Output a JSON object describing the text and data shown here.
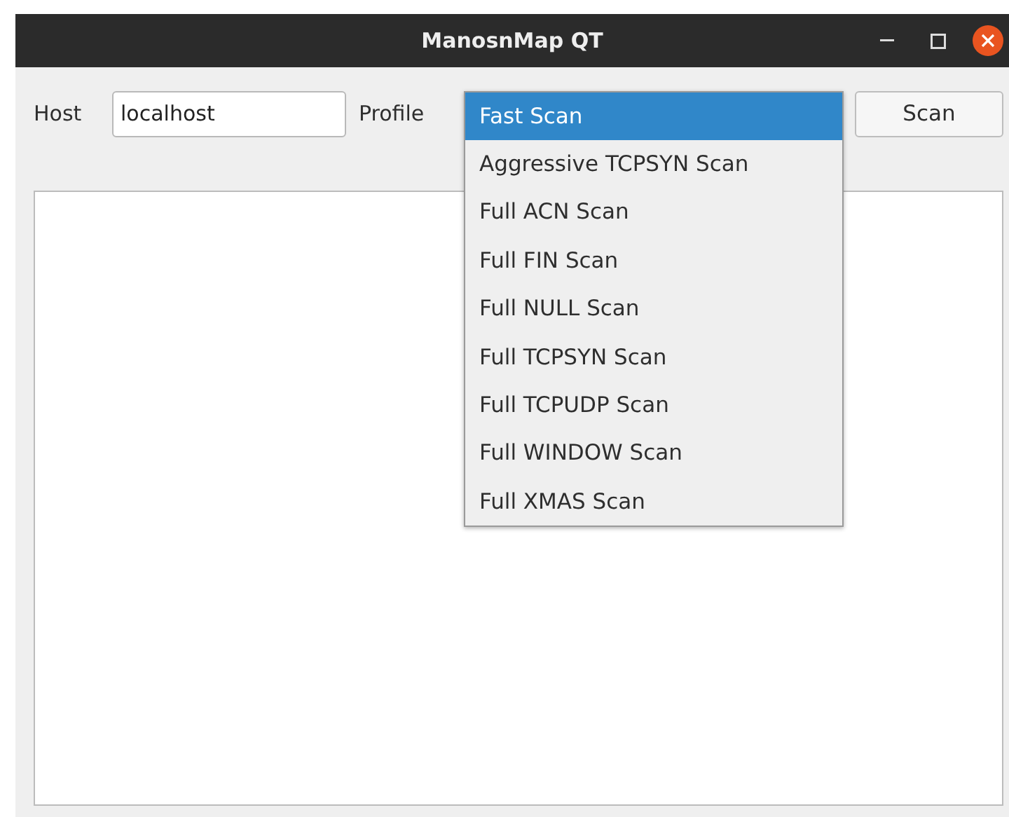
{
  "window": {
    "title": "ManosnMap QT"
  },
  "host": {
    "label": "Host",
    "value": "localhost"
  },
  "profile": {
    "label": "Profile",
    "options": [
      {
        "label": "Fast Scan",
        "selected": true
      },
      {
        "label": "Aggressive TCPSYN Scan",
        "selected": false
      },
      {
        "label": "Full ACN Scan",
        "selected": false
      },
      {
        "label": "Full FIN Scan",
        "selected": false
      },
      {
        "label": "Full NULL Scan",
        "selected": false
      },
      {
        "label": "Full TCPSYN Scan",
        "selected": false
      },
      {
        "label": "Full TCPUDP Scan",
        "selected": false
      },
      {
        "label": "Full WINDOW Scan",
        "selected": false
      },
      {
        "label": "Full XMAS Scan",
        "selected": false
      }
    ]
  },
  "scan_button": "Scan"
}
